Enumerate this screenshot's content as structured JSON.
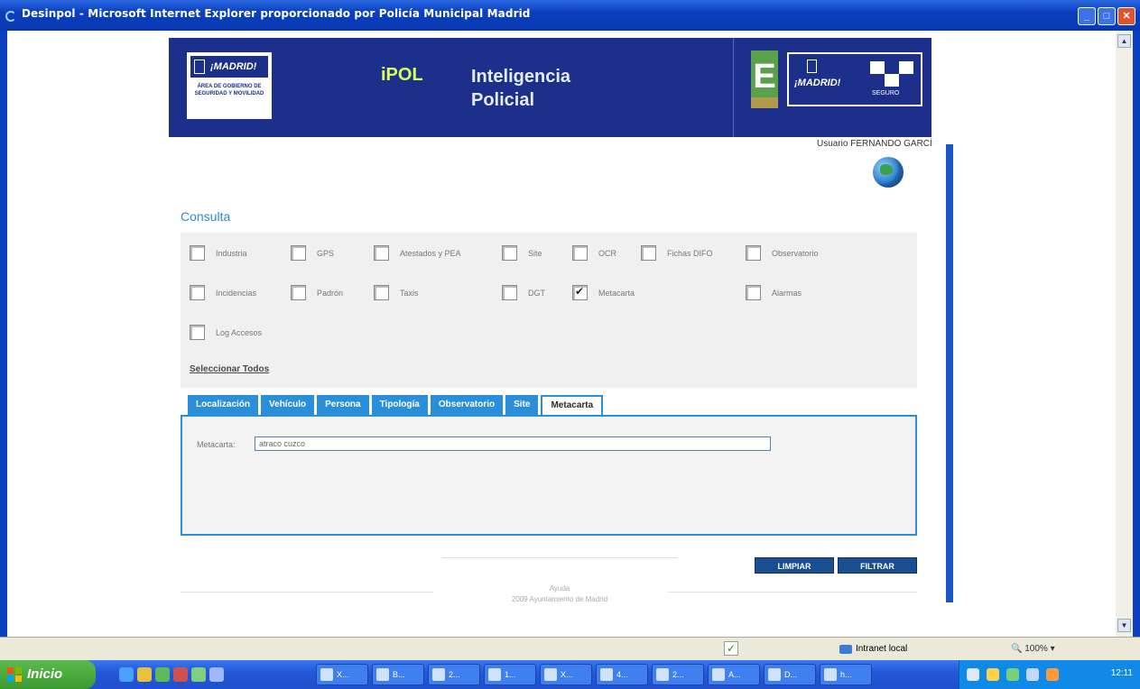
{
  "window": {
    "title": "Desinpol - Microsoft Internet Explorer proporcionado por Policía Municipal Madrid",
    "min_icon": "minimize-icon",
    "max_icon": "maximize-icon",
    "close_icon": "close-icon"
  },
  "header": {
    "madrid_logo_text": "¡MADRID!",
    "madrid_logo_sub": "ÁREA DE GOBIERNO DE SEGURIDAD Y MOVILIDAD",
    "brand": "iPOL",
    "title_line1": "Inteligencia",
    "title_line2": "Policial",
    "seguro_madrid": "¡MADRID!",
    "seguro_label": "SEGURO",
    "e_letter": "E"
  },
  "user": {
    "label": "Usuario FERNANDO GARCÍ"
  },
  "consulta": {
    "title": "Consulta",
    "options": [
      {
        "label": "Industria",
        "checked": false
      },
      {
        "label": "GPS",
        "checked": false
      },
      {
        "label": "Atestados y PEA",
        "checked": false
      },
      {
        "label": "Site",
        "checked": false
      },
      {
        "label": "OCR",
        "checked": false
      },
      {
        "label": "Fichas DIFO",
        "checked": false
      },
      {
        "label": "Observatorio",
        "checked": false
      },
      {
        "label": "Incidencias",
        "checked": false
      },
      {
        "label": "Padrón",
        "checked": false
      },
      {
        "label": "Taxis",
        "checked": false
      },
      {
        "label": "DGT",
        "checked": false
      },
      {
        "label": "Metacarta",
        "checked": true
      },
      {
        "label": "Alarmas",
        "checked": false
      },
      {
        "label": "Log Accesos",
        "checked": false
      }
    ],
    "select_all": "Seleccionar Todos"
  },
  "tabs": [
    "Localización",
    "Vehículo",
    "Persona",
    "Tipología",
    "Observatorio",
    "Site",
    "Metacarta"
  ],
  "active_tab": "Metacarta",
  "metacarta": {
    "label": "Metacarta:",
    "value": "atraco cuzco"
  },
  "buttons": {
    "clear": "LIMPIAR",
    "filter": "FILTRAR"
  },
  "footer": {
    "help": "Ayuda",
    "copyright": "2009 Ayuntamiento de Madrid"
  },
  "statusbar": {
    "zone": "Intranet local",
    "zoom": "100%"
  },
  "taskbar": {
    "start": "Inicio",
    "tasks": [
      "X...",
      "B...",
      "2...",
      "1...",
      "X...",
      "4...",
      "2...",
      "A...",
      "D...",
      "h..."
    ],
    "clock": "12:11"
  }
}
